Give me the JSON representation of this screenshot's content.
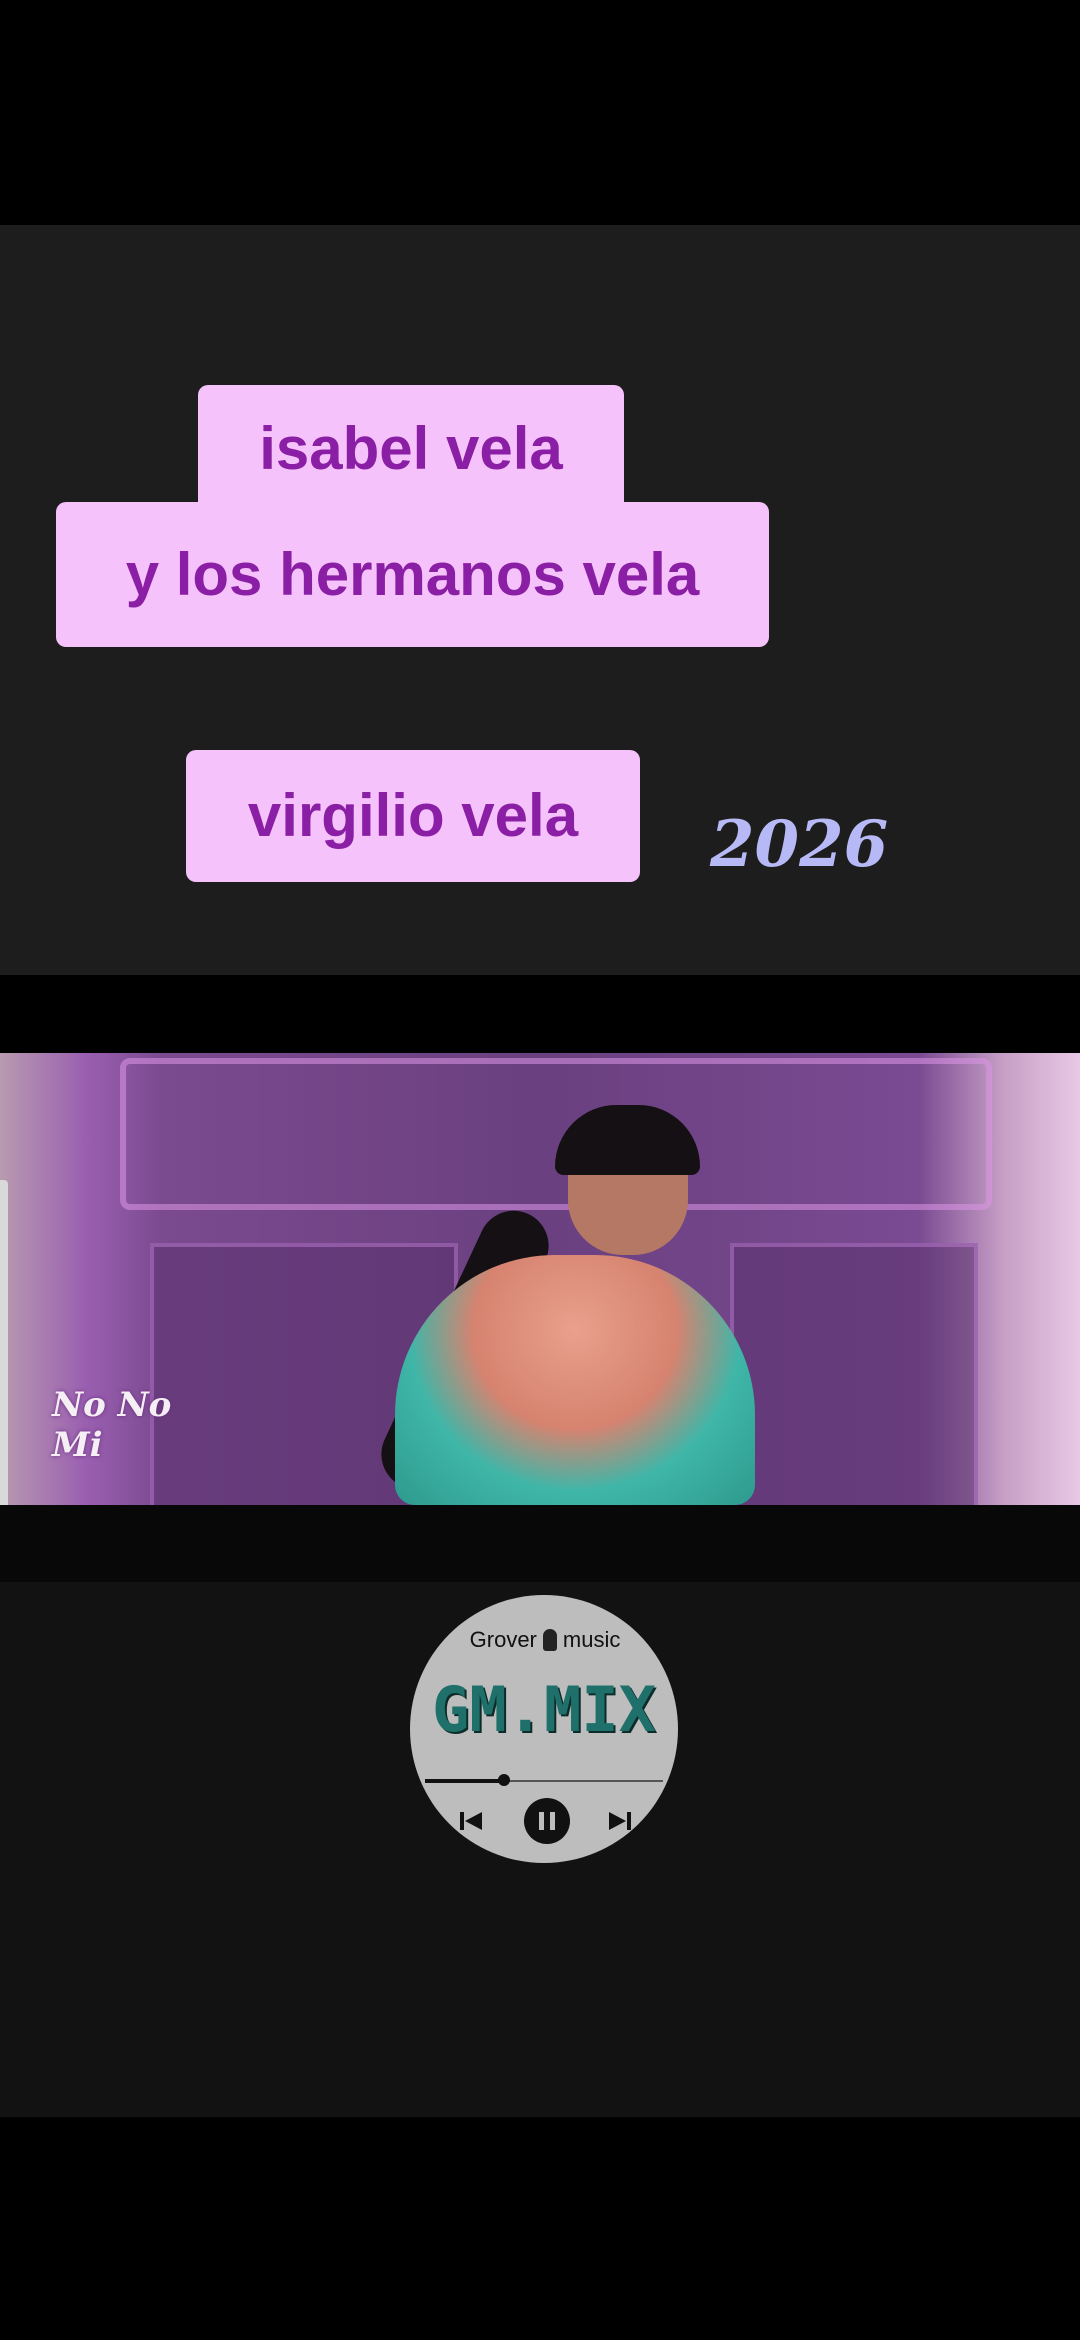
{
  "labels": {
    "line1": "isabel vela",
    "line2": "y los hermanos vela",
    "line3": "virgilio vela",
    "year": "2026"
  },
  "video": {
    "watermark": "No No Mi"
  },
  "music_widget": {
    "brand_left": "Grover",
    "brand_right": "music",
    "title": "GM.MIX",
    "progress": 0.33
  },
  "colors": {
    "label_bg": "#f6c2fb",
    "label_text": "#8a1ea4",
    "year_text": "#b7b9f6",
    "widget_title": "#1f6f6a"
  }
}
